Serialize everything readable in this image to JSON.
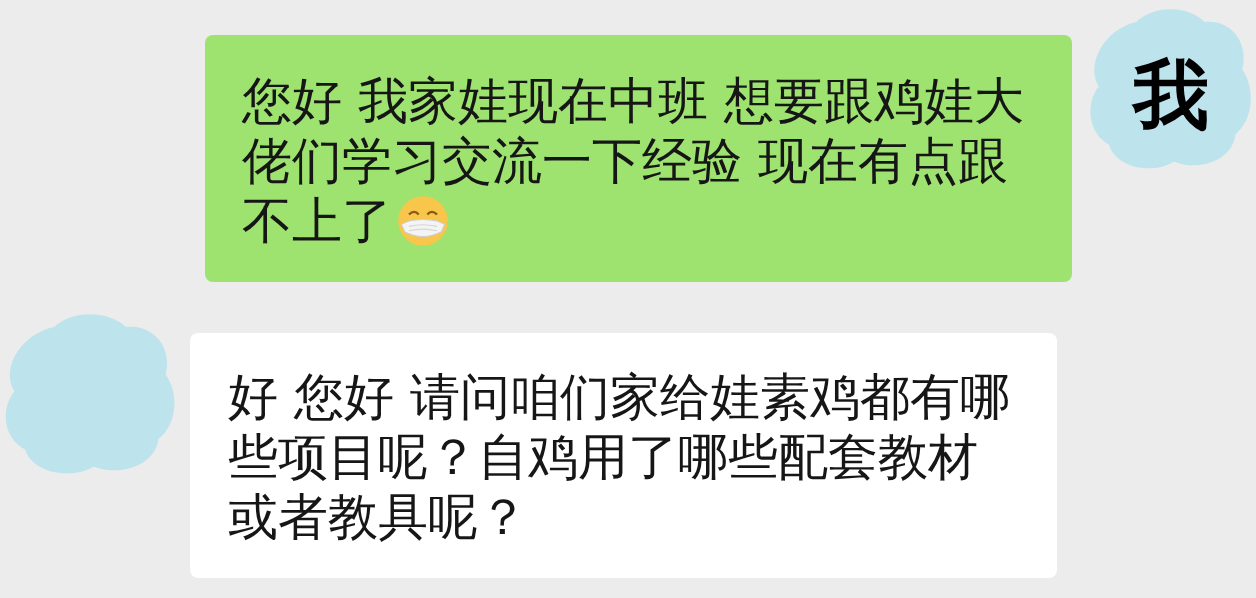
{
  "messages": [
    {
      "kind": "sent",
      "text": "您好 我家娃现在中班 想要跟鸡娃大佬们学习交流一下经验 现在有点跟不上了",
      "has_emoji": true,
      "avatar_label": "我"
    },
    {
      "kind": "received",
      "text": "好 您好 请问咱们家给娃素鸡都有哪些项目呢？自鸡用了哪些配套教材或者教具呢？",
      "has_emoji": false
    }
  ]
}
